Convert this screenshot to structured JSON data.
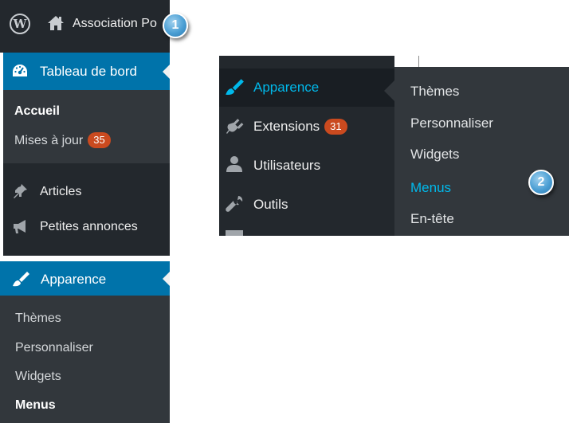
{
  "admin_bar": {
    "site_name": "Association Po"
  },
  "left_menu": {
    "dashboard_label": "Tableau de bord",
    "dashboard_sub": [
      {
        "label": "Accueil"
      },
      {
        "label": "Mises à jour",
        "badge": "35"
      }
    ],
    "items": [
      {
        "label": "Articles"
      },
      {
        "label": "Petites annonces"
      }
    ],
    "appearance_label": "Apparence",
    "appearance_sub": [
      "Thèmes",
      "Personnaliser",
      "Widgets",
      "Menus"
    ]
  },
  "right_menu": {
    "items": [
      {
        "label": "Apparence"
      },
      {
        "label": "Extensions",
        "badge": "31"
      },
      {
        "label": "Utilisateurs"
      },
      {
        "label": "Outils"
      }
    ],
    "flyout": [
      "Thèmes",
      "Personnaliser",
      "Widgets",
      "Menus",
      "En-tête"
    ]
  },
  "callouts": [
    "1",
    "2"
  ],
  "colors": {
    "active_blue": "#0073aa",
    "link_blue": "#00b9eb",
    "badge_red": "#ca4a1f",
    "panel_dark": "#23282d",
    "submenu_dark": "#32373c"
  }
}
